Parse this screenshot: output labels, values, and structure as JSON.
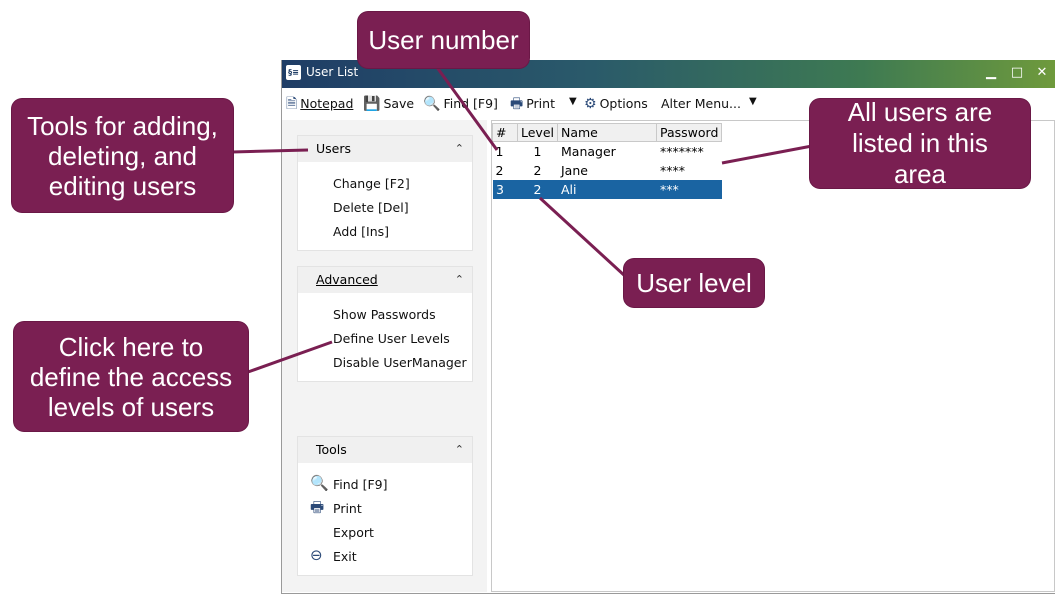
{
  "window": {
    "title": "User List",
    "app_icon_text": "§≡"
  },
  "toolbar": {
    "notepad": "Notepad",
    "save": "Save",
    "find": "Find [F9]",
    "print": "Print",
    "options": "Options",
    "alter_menu": "Alter Menu..."
  },
  "sidebar": {
    "users": {
      "title": "Users",
      "items": [
        "Change [F2]",
        "Delete [Del]",
        "Add [Ins]"
      ]
    },
    "advanced": {
      "title": "Advanced",
      "items": [
        "Show Passwords",
        "Define User Levels",
        "Disable UserManager"
      ]
    },
    "tools": {
      "title": "Tools",
      "items": [
        "Find [F9]",
        "Print",
        "Export",
        "Exit"
      ]
    }
  },
  "table": {
    "columns": [
      "#",
      "Level",
      "Name",
      "Password"
    ],
    "rows": [
      {
        "num": "1",
        "level": "1",
        "name": "Manager",
        "password": "*******"
      },
      {
        "num": "2",
        "level": "2",
        "name": "Jane",
        "password": "****"
      },
      {
        "num": "3",
        "level": "2",
        "name": "Ali",
        "password": "***"
      }
    ]
  },
  "callouts": {
    "user_number": "User number",
    "tools": "Tools for adding, deleting, and editing users",
    "all_users": "All users are listed in this area",
    "user_level": "User level",
    "define_levels": "Click here to define the access levels of users"
  },
  "colors": {
    "callout": "#7a1f52",
    "selection": "#1a64a2",
    "accent": "#2b4a78"
  }
}
